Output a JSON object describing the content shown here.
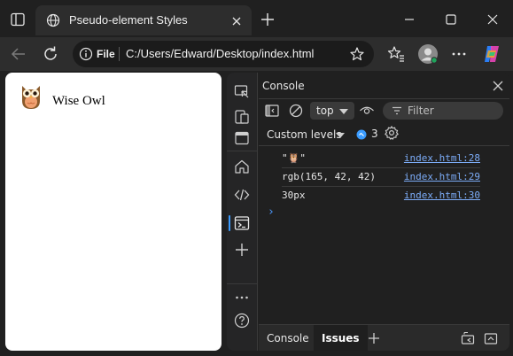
{
  "browser": {
    "tab_title": "Pseudo-element Styles",
    "address": {
      "scheme_label": "File",
      "url": "C:/Users/Edward/Desktop/index.html"
    }
  },
  "page": {
    "emoji": "🦉",
    "text": "Wise Owl"
  },
  "devtools": {
    "panel_title": "Console",
    "context": "top",
    "filter_placeholder": "Filter",
    "levels_label": "Custom levels",
    "issues_count": "3",
    "logs": [
      {
        "message": "\"🦉\"",
        "source": "index.html:28"
      },
      {
        "message": "rgb(165, 42, 42)",
        "source": "index.html:29"
      },
      {
        "message": "30px",
        "source": "index.html:30"
      }
    ],
    "drawer_tabs": [
      {
        "label": "Console",
        "active": false
      },
      {
        "label": "Issues",
        "active": true
      }
    ]
  },
  "colors": {
    "accent": "#3b9cff",
    "link": "#7cacf8",
    "chrome_bg": "#202020",
    "toolbar_bg": "#2d2d2d"
  }
}
